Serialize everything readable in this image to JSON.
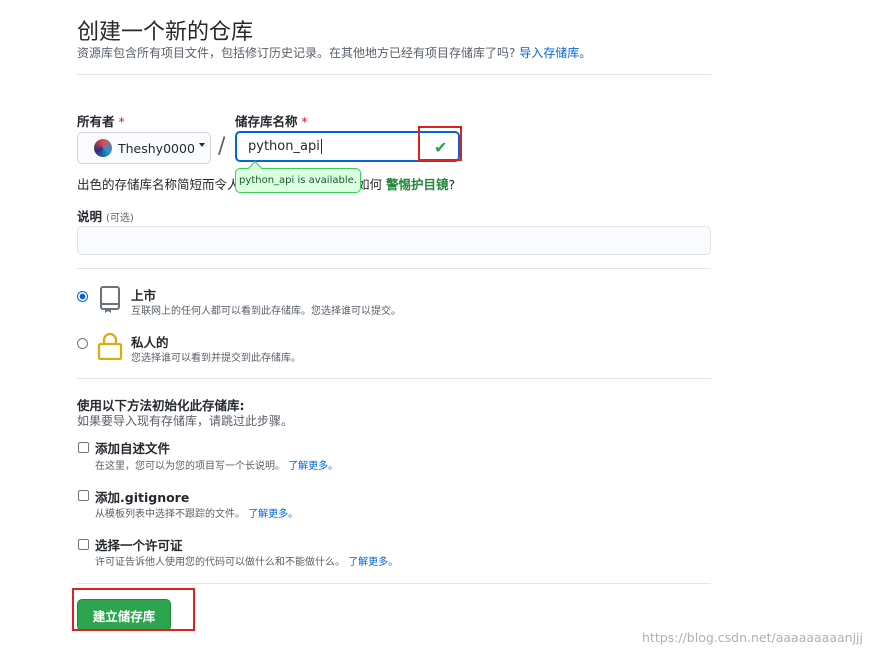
{
  "header": {
    "title": "创建一个新的仓库",
    "subtitle": "资源库包含所有项目文件，包括修订历史记录。在其他地方已经有项目存储库了吗?",
    "import_link": "导入存储库。"
  },
  "owner": {
    "label": "所有者",
    "required_mark": "*",
    "value": "Theshy0000"
  },
  "repo_name": {
    "label": "储存库名称",
    "required_mark": "*",
    "value": "python_api",
    "available_tooltip": "python_api is available."
  },
  "separator": "/",
  "hint": {
    "text_before": "出色的存储库名称简短而令人",
    "text_after": "如何",
    "suggestion": "警惕护目镜",
    "suffix": "?"
  },
  "description": {
    "label": "说明",
    "optional": "(可选)",
    "value": ""
  },
  "visibility": {
    "public": {
      "title": "上市",
      "desc": "互联网上的任何人都可以看到此存储库。您选择谁可以提交。",
      "selected": true
    },
    "private": {
      "title": "私人的",
      "desc": "您选择谁可以看到并提交到此存储库。",
      "selected": false
    }
  },
  "init": {
    "title": "使用以下方法初始化此存储库:",
    "subtitle": "如果要导入现有存储库，请跳过此步骤。",
    "readme": {
      "title": "添加自述文件",
      "desc": "在这里，您可以为您的项目写一个长说明。",
      "link": "了解更多。",
      "checked": false
    },
    "gitignore": {
      "title": "添加.gitignore",
      "desc": "从模板列表中选择不跟踪的文件。",
      "link": "了解更多。",
      "checked": false
    },
    "license": {
      "title": "选择一个许可证",
      "desc": "许可证告诉他人使用您的代码可以做什么和不能做什么。",
      "link": "了解更多。",
      "checked": false
    }
  },
  "create_button": "建立储存库",
  "watermark": "https://blog.csdn.net/aaaaaaaaanjjj",
  "colors": {
    "accent": "#0366d6",
    "success": "#28a745",
    "button": "#2ea44f",
    "highlight_box": "#e02020"
  }
}
